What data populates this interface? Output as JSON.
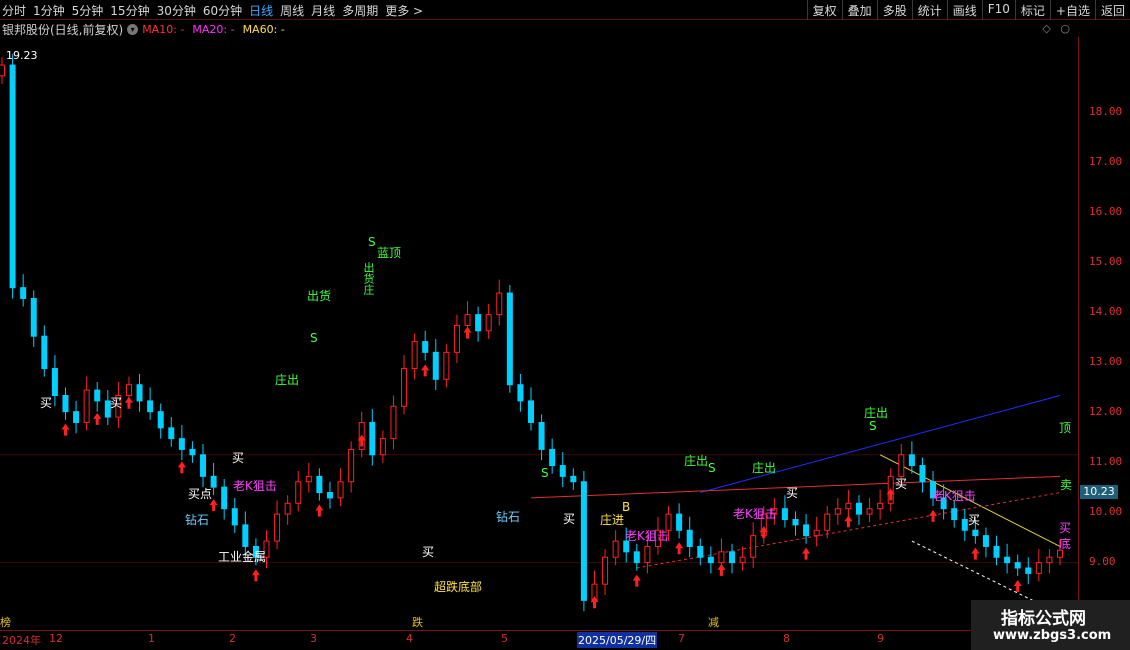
{
  "toolbar": {
    "periods": [
      "分时",
      "1分钟",
      "5分钟",
      "15分钟",
      "30分钟",
      "60分钟",
      "日线",
      "周线",
      "月线",
      "多周期",
      "更多 >"
    ],
    "active_period": "日线",
    "actions": [
      "复权",
      "叠加",
      "多股",
      "统计",
      "画线",
      "F10",
      "标记",
      "+自选",
      "返回"
    ]
  },
  "info": {
    "stock_title": "银邦股份(日线,前复权)",
    "ma10": "MA10: -",
    "ma20": "MA20: -",
    "ma60": "MA60: -"
  },
  "price_axis": {
    "ticks": [
      "18.00",
      "17.00",
      "16.00",
      "15.00",
      "14.00",
      "13.00",
      "12.00",
      "11.00",
      "10.00",
      "9.00"
    ],
    "current_price": "10.23",
    "high_marker": "19.23"
  },
  "date_axis": {
    "ticks": [
      "2024年",
      "12",
      "1",
      "2",
      "3",
      "4",
      "5",
      "2025/05/29/四",
      "7",
      "8",
      "9"
    ],
    "cursor_date": "2025/05/29/四"
  },
  "row_labels": [
    "榜",
    "跌",
    "减"
  ],
  "industry": "工业金属",
  "signals": {
    "buy": "买",
    "buy_point": "买点",
    "diamond": "钻石",
    "chase": "老K狙击",
    "dealer_out": "庄出",
    "ship": "出货",
    "blue_top": "蓝顶",
    "dealer_in": "庄进",
    "sell_s": "S",
    "buy_b": "B",
    "bottom": "超跌底部",
    "top": "顶",
    "sell": "卖",
    "base": "底",
    "ship_vertical": "出货庄"
  },
  "watermark": {
    "line1": "指标公式网",
    "line2": "www.zbgs3.com"
  },
  "colors": {
    "up": "#ff2020",
    "down": "#00d0ff",
    "axis": "#e03030",
    "blue_trend": "#2030ff",
    "yellow_trend": "#e0d040"
  },
  "chart_data": {
    "type": "candlestick",
    "ylim": [
      8.75,
      19.75
    ],
    "note_axis": "price",
    "closes": [
      19.23,
      15.1,
      14.9,
      14.2,
      13.6,
      13.1,
      12.8,
      12.6,
      13.2,
      13.0,
      12.7,
      13.1,
      13.3,
      13.0,
      12.8,
      12.5,
      12.3,
      12.1,
      12.0,
      11.6,
      11.4,
      11.0,
      10.7,
      10.3,
      10.1,
      10.4,
      10.9,
      11.1,
      11.5,
      11.6,
      11.3,
      11.2,
      11.5,
      12.1,
      12.6,
      12.0,
      12.3,
      12.9,
      13.6,
      14.1,
      13.9,
      13.4,
      13.9,
      14.4,
      14.6,
      14.3,
      14.6,
      15.0,
      13.3,
      13.0,
      12.6,
      12.1,
      11.8,
      11.6,
      11.5,
      9.3,
      9.6,
      10.1,
      10.4,
      10.2,
      10.0,
      10.3,
      10.6,
      10.9,
      10.6,
      10.3,
      10.1,
      10.0,
      10.2,
      10.0,
      10.1,
      10.5,
      10.9,
      11.0,
      10.8,
      10.7,
      10.5,
      10.6,
      10.9,
      11.0,
      11.1,
      10.9,
      11.0,
      11.1,
      11.6,
      12.0,
      11.8,
      11.5,
      11.2,
      11.0,
      10.8,
      10.6,
      10.5,
      10.3,
      10.1,
      10.0,
      9.9,
      9.8,
      10.0,
      10.1,
      10.23
    ]
  }
}
